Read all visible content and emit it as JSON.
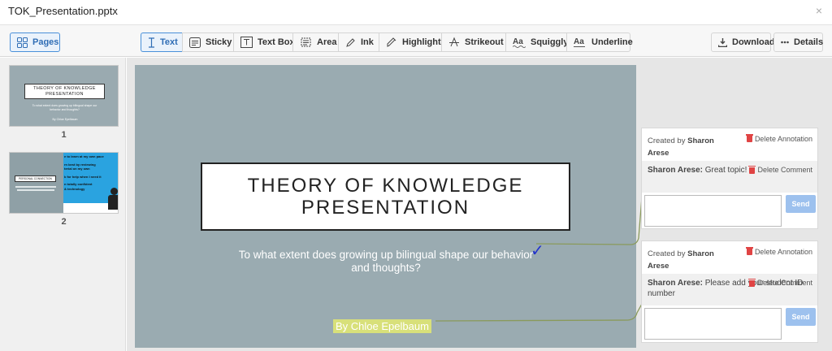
{
  "window": {
    "title": "TOK_Presentation.pptx",
    "close_glyph": "×"
  },
  "toolbar": {
    "pages_label": "Pages",
    "tools": [
      {
        "label": "Text",
        "icon": "text-cursor-icon"
      },
      {
        "label": "Sticky",
        "icon": "sticky-note-icon"
      },
      {
        "label": "Text Box",
        "icon": "text-box-icon"
      },
      {
        "label": "Area",
        "icon": "area-icon"
      },
      {
        "label": "Ink",
        "icon": "pen-icon"
      },
      {
        "label": "Highlight",
        "icon": "highlighter-icon"
      },
      {
        "label": "Strikeout",
        "icon": "strikeout-icon"
      },
      {
        "label": "Squiggly",
        "icon": "squiggly-icon"
      },
      {
        "label": "Underline",
        "icon": "underline-icon"
      }
    ],
    "active_tool": "Text",
    "download_label": "Download",
    "details_label": "Details"
  },
  "thumbnails": [
    {
      "number": "1",
      "title": "THEORY OF KNOWLEDGE PRESENTATION",
      "subtitle": "To what extent does growing up bilingual shape our behavior and thoughts?",
      "author": "By Chloe Epelbaum"
    },
    {
      "number": "2",
      "left_box": "PERSONAL CONNECTION",
      "lines": [
        "e to learn at my own pace",
        "rn best by reviewing",
        "terial on my own",
        "k for help when I need it",
        "n totally confident",
        "& technology"
      ]
    }
  ],
  "slide": {
    "title": "THEORY OF KNOWLEDGE PRESENTATION",
    "subtitle": "To what extent does growing up bilingual shape our behavior and thoughts?",
    "author": "By Chloe Epelbaum",
    "check_glyph": "✓"
  },
  "annotations": [
    {
      "created_by_prefix": "Created by",
      "author": "Sharon Arese",
      "delete_annotation_label": "Delete Annotation",
      "comment_author": "Sharon Arese:",
      "comment_text": "Great topic!",
      "delete_comment_label": "Delete Comment",
      "send_label": "Send"
    },
    {
      "created_by_prefix": "Created by",
      "author": "Sharon Arese",
      "delete_annotation_label": "Delete Annotation",
      "comment_author": "Sharon Arese:",
      "comment_text": "Please add your student ID number",
      "delete_comment_label": "Delete Comment",
      "send_label": "Send"
    }
  ],
  "colors": {
    "accent": "#2f6db5",
    "slide_background": "#9aabb1",
    "highlight": "#d8e07a",
    "connector": "#8a9a5b",
    "send_button": "#9dc1ee",
    "delete_icon": "#e04444",
    "checkmark": "#2233cc"
  }
}
